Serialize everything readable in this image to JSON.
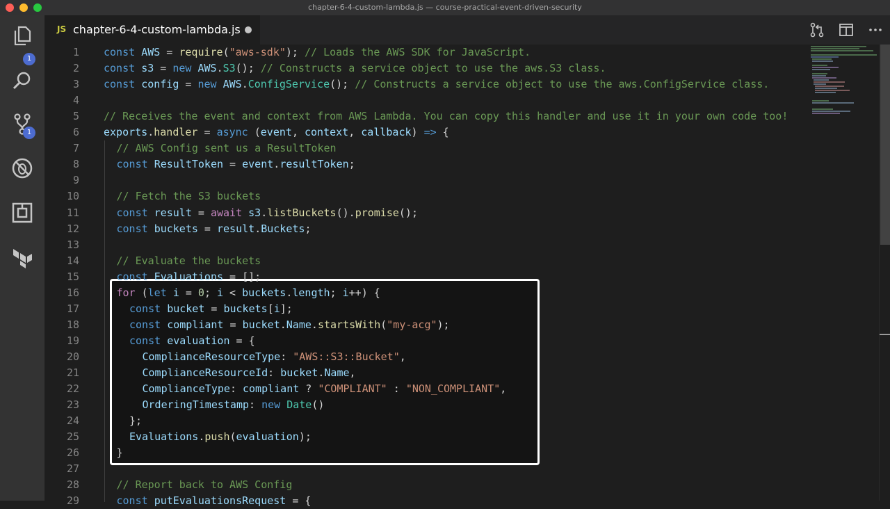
{
  "window": {
    "title": "chapter-6-4-custom-lambda.js — course-practical-event-driven-security"
  },
  "activity_bar": {
    "explorer_badge": "1",
    "source_control_badge": "1"
  },
  "tab": {
    "lang": "JS",
    "filename": "chapter-6-4-custom-lambda.js"
  },
  "colors": {
    "keyword": "#569cd6",
    "control": "#c586c0",
    "string": "#ce9178",
    "comment": "#6a9955",
    "variable": "#9cdcfe",
    "function": "#dcdcaa",
    "class": "#4ec9b0",
    "number": "#b5cea8",
    "highlight_border": "#ffffff"
  },
  "code_lines": [
    {
      "n": "1",
      "indent": 0,
      "tokens": [
        {
          "t": "const",
          "c": "kw"
        },
        {
          "t": " "
        },
        {
          "t": "AWS",
          "c": "var"
        },
        {
          "t": " = "
        },
        {
          "t": "require",
          "c": "fn"
        },
        {
          "t": "("
        },
        {
          "t": "\"aws-sdk\"",
          "c": "str"
        },
        {
          "t": "); "
        },
        {
          "t": "// Loads the AWS SDK for JavaScript.",
          "c": "cm"
        }
      ]
    },
    {
      "n": "2",
      "indent": 0,
      "tokens": [
        {
          "t": "const",
          "c": "kw"
        },
        {
          "t": " "
        },
        {
          "t": "s3",
          "c": "var"
        },
        {
          "t": " = "
        },
        {
          "t": "new",
          "c": "kw"
        },
        {
          "t": " "
        },
        {
          "t": "AWS",
          "c": "var"
        },
        {
          "t": "."
        },
        {
          "t": "S3",
          "c": "cls"
        },
        {
          "t": "(); "
        },
        {
          "t": "// Constructs a service object to use the aws.S3 class.",
          "c": "cm"
        }
      ]
    },
    {
      "n": "3",
      "indent": 0,
      "tokens": [
        {
          "t": "const",
          "c": "kw"
        },
        {
          "t": " "
        },
        {
          "t": "config",
          "c": "var"
        },
        {
          "t": " = "
        },
        {
          "t": "new",
          "c": "kw"
        },
        {
          "t": " "
        },
        {
          "t": "AWS",
          "c": "var"
        },
        {
          "t": "."
        },
        {
          "t": "ConfigService",
          "c": "cls"
        },
        {
          "t": "(); "
        },
        {
          "t": "// Constructs a service object to use the aws.ConfigService class.",
          "c": "cm"
        }
      ]
    },
    {
      "n": "4",
      "indent": 0,
      "tokens": []
    },
    {
      "n": "5",
      "indent": 0,
      "tokens": [
        {
          "t": "// Receives the event and context from AWS Lambda. You can copy this handler and use it in your own code too!",
          "c": "cm"
        }
      ]
    },
    {
      "n": "6",
      "indent": 0,
      "tokens": [
        {
          "t": "exports",
          "c": "var"
        },
        {
          "t": "."
        },
        {
          "t": "handler",
          "c": "fn"
        },
        {
          "t": " = "
        },
        {
          "t": "async",
          "c": "kw"
        },
        {
          "t": " ("
        },
        {
          "t": "event",
          "c": "var"
        },
        {
          "t": ", "
        },
        {
          "t": "context",
          "c": "var"
        },
        {
          "t": ", "
        },
        {
          "t": "callback",
          "c": "var"
        },
        {
          "t": ") "
        },
        {
          "t": "=>",
          "c": "kw"
        },
        {
          "t": " {"
        }
      ]
    },
    {
      "n": "7",
      "indent": 1,
      "tokens": [
        {
          "t": "// AWS Config sent us a ResultToken",
          "c": "cm"
        }
      ]
    },
    {
      "n": "8",
      "indent": 1,
      "tokens": [
        {
          "t": "const",
          "c": "kw"
        },
        {
          "t": " "
        },
        {
          "t": "ResultToken",
          "c": "var"
        },
        {
          "t": " = "
        },
        {
          "t": "event",
          "c": "var"
        },
        {
          "t": "."
        },
        {
          "t": "resultToken",
          "c": "var"
        },
        {
          "t": ";"
        }
      ]
    },
    {
      "n": "9",
      "indent": 1,
      "tokens": []
    },
    {
      "n": "10",
      "indent": 1,
      "tokens": [
        {
          "t": "// Fetch the S3 buckets",
          "c": "cm"
        }
      ]
    },
    {
      "n": "11",
      "indent": 1,
      "tokens": [
        {
          "t": "const",
          "c": "kw"
        },
        {
          "t": " "
        },
        {
          "t": "result",
          "c": "var"
        },
        {
          "t": " = "
        },
        {
          "t": "await",
          "c": "ctl"
        },
        {
          "t": " "
        },
        {
          "t": "s3",
          "c": "var"
        },
        {
          "t": "."
        },
        {
          "t": "listBuckets",
          "c": "fn"
        },
        {
          "t": "()."
        },
        {
          "t": "promise",
          "c": "fn"
        },
        {
          "t": "();"
        }
      ]
    },
    {
      "n": "12",
      "indent": 1,
      "tokens": [
        {
          "t": "const",
          "c": "kw"
        },
        {
          "t": " "
        },
        {
          "t": "buckets",
          "c": "var"
        },
        {
          "t": " = "
        },
        {
          "t": "result",
          "c": "var"
        },
        {
          "t": "."
        },
        {
          "t": "Buckets",
          "c": "var"
        },
        {
          "t": ";"
        }
      ]
    },
    {
      "n": "13",
      "indent": 1,
      "tokens": []
    },
    {
      "n": "14",
      "indent": 1,
      "tokens": [
        {
          "t": "// Evaluate the buckets",
          "c": "cm"
        }
      ]
    },
    {
      "n": "15",
      "indent": 1,
      "tokens": [
        {
          "t": "const",
          "c": "kw"
        },
        {
          "t": " "
        },
        {
          "t": "Evaluations",
          "c": "var"
        },
        {
          "t": " = [];"
        }
      ]
    },
    {
      "n": "16",
      "indent": 1,
      "tokens": [
        {
          "t": "for",
          "c": "ctl"
        },
        {
          "t": " ("
        },
        {
          "t": "let",
          "c": "kw"
        },
        {
          "t": " "
        },
        {
          "t": "i",
          "c": "var"
        },
        {
          "t": " = "
        },
        {
          "t": "0",
          "c": "num"
        },
        {
          "t": "; "
        },
        {
          "t": "i",
          "c": "var"
        },
        {
          "t": " < "
        },
        {
          "t": "buckets",
          "c": "var"
        },
        {
          "t": "."
        },
        {
          "t": "length",
          "c": "var"
        },
        {
          "t": "; "
        },
        {
          "t": "i",
          "c": "var"
        },
        {
          "t": "++) {"
        }
      ]
    },
    {
      "n": "17",
      "indent": 2,
      "tokens": [
        {
          "t": "const",
          "c": "kw"
        },
        {
          "t": " "
        },
        {
          "t": "bucket",
          "c": "var"
        },
        {
          "t": " = "
        },
        {
          "t": "buckets",
          "c": "var"
        },
        {
          "t": "["
        },
        {
          "t": "i",
          "c": "var"
        },
        {
          "t": "];"
        }
      ]
    },
    {
      "n": "18",
      "indent": 2,
      "tokens": [
        {
          "t": "const",
          "c": "kw"
        },
        {
          "t": " "
        },
        {
          "t": "compliant",
          "c": "var"
        },
        {
          "t": " = "
        },
        {
          "t": "bucket",
          "c": "var"
        },
        {
          "t": "."
        },
        {
          "t": "Name",
          "c": "var"
        },
        {
          "t": "."
        },
        {
          "t": "startsWith",
          "c": "fn"
        },
        {
          "t": "("
        },
        {
          "t": "\"my-acg\"",
          "c": "str"
        },
        {
          "t": ");"
        }
      ]
    },
    {
      "n": "19",
      "indent": 2,
      "tokens": [
        {
          "t": "const",
          "c": "kw"
        },
        {
          "t": " "
        },
        {
          "t": "evaluation",
          "c": "var"
        },
        {
          "t": " = {"
        }
      ]
    },
    {
      "n": "20",
      "indent": 3,
      "tokens": [
        {
          "t": "ComplianceResourceType",
          "c": "var"
        },
        {
          "t": ": "
        },
        {
          "t": "\"AWS::S3::Bucket\"",
          "c": "str"
        },
        {
          "t": ","
        }
      ]
    },
    {
      "n": "21",
      "indent": 3,
      "tokens": [
        {
          "t": "ComplianceResourceId",
          "c": "var"
        },
        {
          "t": ": "
        },
        {
          "t": "bucket",
          "c": "var"
        },
        {
          "t": "."
        },
        {
          "t": "Name",
          "c": "var"
        },
        {
          "t": ","
        }
      ]
    },
    {
      "n": "22",
      "indent": 3,
      "tokens": [
        {
          "t": "ComplianceType",
          "c": "var"
        },
        {
          "t": ": "
        },
        {
          "t": "compliant",
          "c": "var"
        },
        {
          "t": " ? "
        },
        {
          "t": "\"COMPLIANT\"",
          "c": "str"
        },
        {
          "t": " : "
        },
        {
          "t": "\"NON_COMPLIANT\"",
          "c": "str"
        },
        {
          "t": ","
        }
      ]
    },
    {
      "n": "23",
      "indent": 3,
      "tokens": [
        {
          "t": "OrderingTimestamp",
          "c": "var"
        },
        {
          "t": ": "
        },
        {
          "t": "new",
          "c": "kw"
        },
        {
          "t": " "
        },
        {
          "t": "Date",
          "c": "cls"
        },
        {
          "t": "()"
        }
      ]
    },
    {
      "n": "24",
      "indent": 2,
      "tokens": [
        {
          "t": "};"
        }
      ]
    },
    {
      "n": "25",
      "indent": 2,
      "tokens": [
        {
          "t": "Evaluations",
          "c": "var"
        },
        {
          "t": "."
        },
        {
          "t": "push",
          "c": "fn"
        },
        {
          "t": "("
        },
        {
          "t": "evaluation",
          "c": "var"
        },
        {
          "t": ");"
        }
      ]
    },
    {
      "n": "26",
      "indent": 1,
      "tokens": [
        {
          "t": "}"
        }
      ]
    },
    {
      "n": "27",
      "indent": 1,
      "tokens": []
    },
    {
      "n": "28",
      "indent": 1,
      "tokens": [
        {
          "t": "// Report back to AWS Config",
          "c": "cm"
        }
      ]
    },
    {
      "n": "29",
      "indent": 1,
      "tokens": [
        {
          "t": "const",
          "c": "kw"
        },
        {
          "t": " "
        },
        {
          "t": "putEvaluationsRequest",
          "c": "var"
        },
        {
          "t": " = {"
        }
      ]
    }
  ]
}
